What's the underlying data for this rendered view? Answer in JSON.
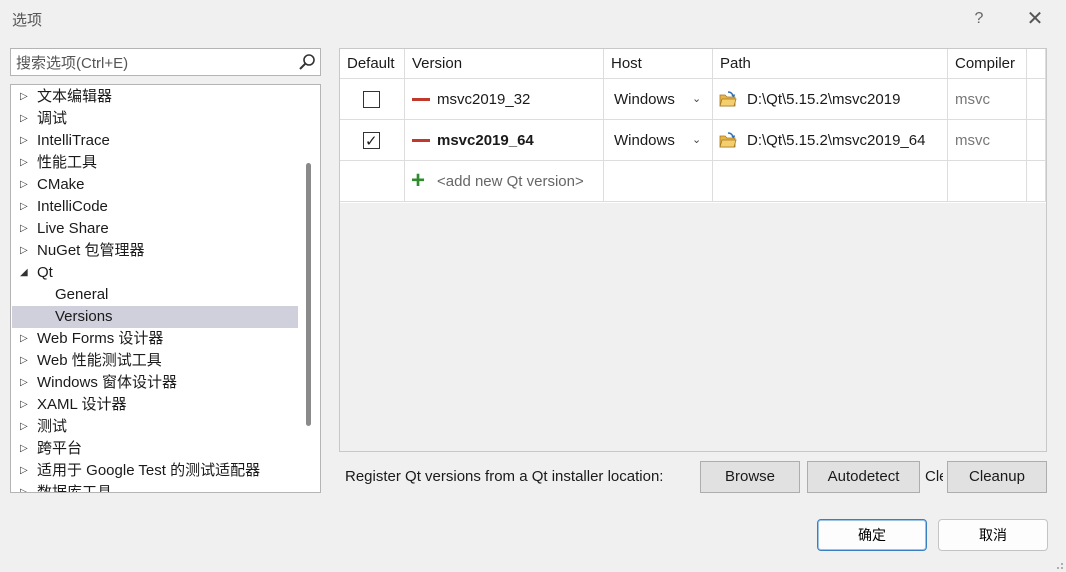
{
  "window": {
    "title": "选项",
    "help_label": "?",
    "close_label": "✕"
  },
  "search": {
    "placeholder": "搜索选项(Ctrl+E)",
    "icon": "search-icon"
  },
  "tree": {
    "items": [
      {
        "label": "文本编辑器",
        "expanded": false
      },
      {
        "label": "调试",
        "expanded": false
      },
      {
        "label": "IntelliTrace",
        "expanded": false
      },
      {
        "label": "性能工具",
        "expanded": false
      },
      {
        "label": "CMake",
        "expanded": false
      },
      {
        "label": "IntelliCode",
        "expanded": false
      },
      {
        "label": "Live Share",
        "expanded": false
      },
      {
        "label": "NuGet 包管理器",
        "expanded": false
      },
      {
        "label": "Qt",
        "expanded": true
      },
      {
        "label": "General",
        "child": true
      },
      {
        "label": "Versions",
        "child": true,
        "selected": true
      },
      {
        "label": "Web Forms 设计器",
        "expanded": false
      },
      {
        "label": "Web 性能测试工具",
        "expanded": false
      },
      {
        "label": "Windows 窗体设计器",
        "expanded": false
      },
      {
        "label": "XAML 设计器",
        "expanded": false
      },
      {
        "label": "测试",
        "expanded": false
      },
      {
        "label": "跨平台",
        "expanded": false
      },
      {
        "label": "适用于 Google Test 的测试适配器",
        "expanded": false
      },
      {
        "label": "数据库工具",
        "expanded": false
      }
    ]
  },
  "grid": {
    "columns": [
      "Default",
      "Version",
      "Host",
      "Path",
      "Compiler"
    ],
    "rows": [
      {
        "default": false,
        "version": "msvc2019_32",
        "host": "Windows",
        "path": "D:\\Qt\\5.15.2\\msvc2019",
        "compiler": "msvc",
        "bold": false
      },
      {
        "default": true,
        "version": "msvc2019_64",
        "host": "Windows",
        "path": "D:\\Qt\\5.15.2\\msvc2019_64",
        "compiler": "msvc",
        "bold": true
      }
    ],
    "add_new_label": "<add new Qt version>",
    "check_mark": "✓",
    "chevron": "⌄"
  },
  "footer": {
    "register_label": "Register Qt versions from a Qt installer location:",
    "browse_label": "Browse",
    "autodetect_label": "Autodetect",
    "clipped_label": "Cle",
    "cleanup_label": "Cleanup"
  },
  "dialog": {
    "ok_label": "确定",
    "cancel_label": "取消"
  },
  "colors": {
    "accent": "#3a7fc4",
    "selected": "#cfd0dc",
    "remove_dash": "#c0392b",
    "plus": "#2e8b2e"
  }
}
